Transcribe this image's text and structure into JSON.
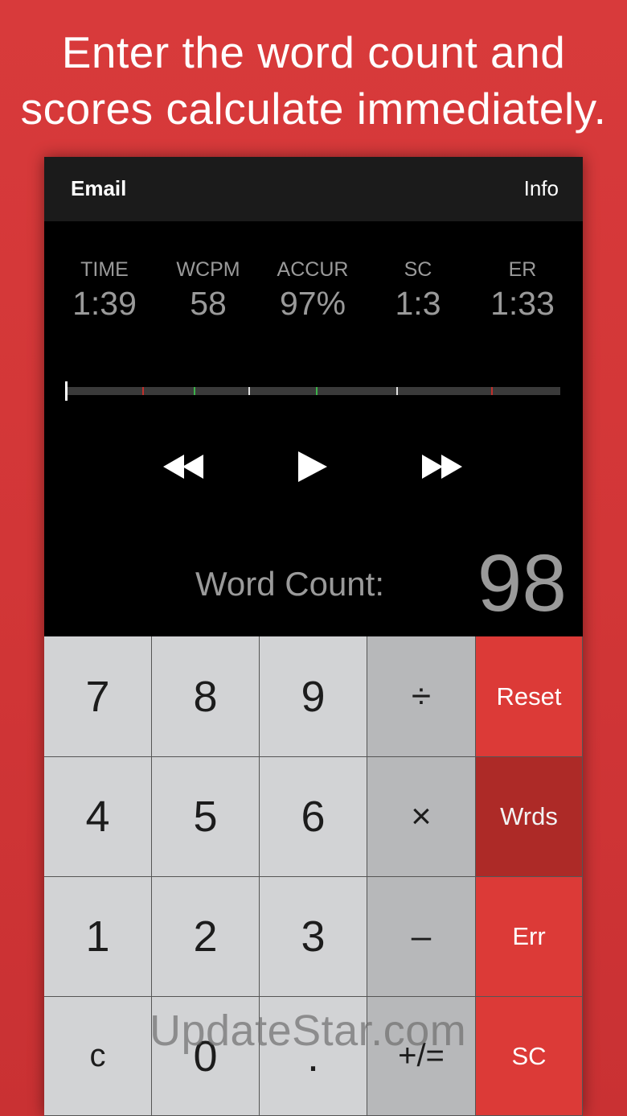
{
  "headline": {
    "line1": "Enter the word count and",
    "line2": "scores calculate immediately."
  },
  "topbar": {
    "email_label": "Email",
    "info_label": "Info"
  },
  "stats": [
    {
      "label": "TIME",
      "value": "1:39"
    },
    {
      "label": "WCPM",
      "value": "58"
    },
    {
      "label": "ACCUR",
      "value": "97%"
    },
    {
      "label": "SC",
      "value": "1:3"
    },
    {
      "label": "ER",
      "value": "1:33"
    }
  ],
  "timeline": {
    "colors": {
      "track": "#3a3a3a",
      "error": "#c0302c",
      "self_correct": "#3cb34a",
      "word": "#e0e0e0",
      "cursor": "#ffffff"
    }
  },
  "transport": {
    "rewind_icon": "rewind-icon",
    "play_icon": "play-icon",
    "fast_forward_icon": "fast-forward-icon"
  },
  "word_count": {
    "label": "Word Count:",
    "value": "98"
  },
  "keypad": {
    "rows": [
      [
        "7",
        "8",
        "9",
        "÷",
        "Reset"
      ],
      [
        "4",
        "5",
        "6",
        "×",
        "Wrds"
      ],
      [
        "1",
        "2",
        "3",
        "–",
        "Err"
      ],
      [
        "c",
        "0",
        ".",
        "+/=",
        "SC"
      ]
    ],
    "selected_key": "Wrds",
    "colors": {
      "number": "#d2d3d5",
      "operator": "#b7b8ba",
      "action": "#dc3a37",
      "action_selected": "#ad2a27"
    }
  },
  "watermark": "UpdateStar.com"
}
